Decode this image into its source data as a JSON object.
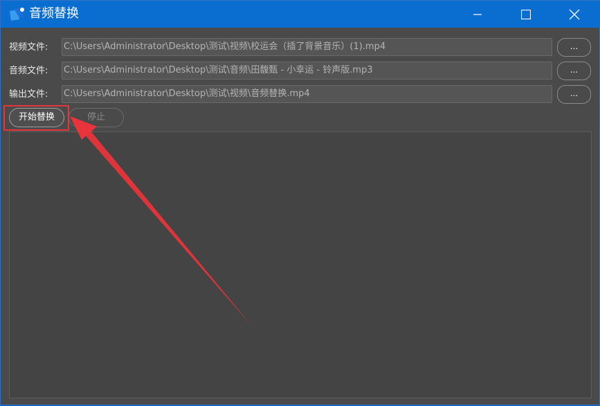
{
  "window": {
    "title": "音频替换",
    "icons": {
      "app": "app-logo-icon",
      "minimize": "minimize-icon",
      "maximize": "maximize-icon",
      "close": "close-icon"
    }
  },
  "form": {
    "video": {
      "label": "视频文件:",
      "value": "C:\\Users\\Administrator\\Desktop\\测试\\视频\\校运会（插了背景音乐）(1).mp4",
      "browse_label": "..."
    },
    "audio": {
      "label": "音频文件:",
      "value": "C:\\Users\\Administrator\\Desktop\\测试\\音频\\田馥甄 - 小幸运 - 铃声版.mp3",
      "browse_label": "..."
    },
    "output": {
      "label": "输出文件:",
      "value": "C:\\Users\\Administrator\\Desktop\\测试\\视频\\音频替换.mp4",
      "browse_label": "..."
    }
  },
  "actions": {
    "start_label": "开始替换",
    "stop_label": "停止"
  },
  "colors": {
    "titlebar": "#0a6ed1",
    "background": "#4a4a4a",
    "annotation": "#e8343a"
  }
}
